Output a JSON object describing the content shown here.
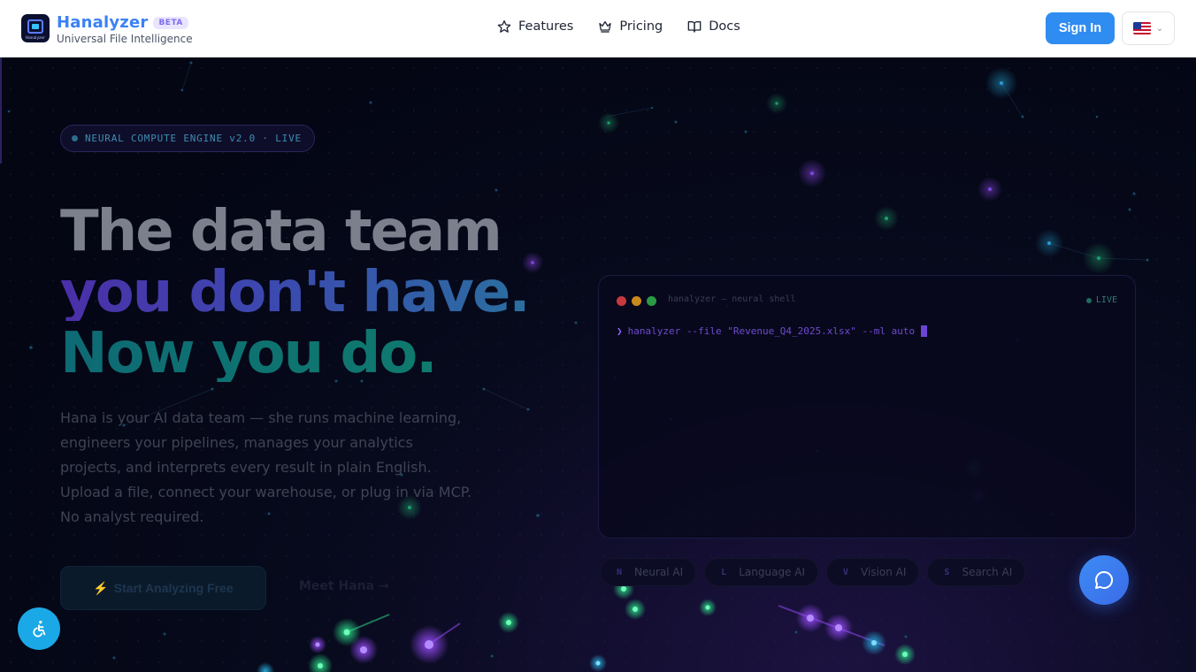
{
  "header": {
    "brand_name": "Hanalyzer",
    "beta_label": "BETA",
    "tagline": "Universal File Intelligence",
    "logo_text": "Hanalyzer",
    "nav": [
      {
        "label": "Features",
        "icon": "star-icon"
      },
      {
        "label": "Pricing",
        "icon": "crown-icon"
      },
      {
        "label": "Docs",
        "icon": "book-icon"
      }
    ],
    "sign_in_label": "Sign In",
    "language": {
      "selected": "en-US",
      "icon": "us-flag-icon"
    }
  },
  "hero": {
    "badge": "NEURAL COMPUTE ENGINE v2.0 · LIVE",
    "headline_line1": "The data team",
    "headline_line2": "you don't have.",
    "headline_line3": "Now you do.",
    "description": "Hana is your AI data team — she runs machine learning, engineers your pipelines, manages your analytics projects, and interprets every result in plain English. Upload a file, connect your warehouse, or plug in via MCP. No analyst required.",
    "cta_primary": "Start Analyzing Free",
    "cta_primary_icon": "⚡",
    "cta_secondary": "Meet Hana →"
  },
  "terminal": {
    "title": "hanalyzer — neural shell",
    "live_label": "LIVE",
    "prompt": "❯",
    "command": "hanalyzer --file \"Revenue_Q4_2025.xlsx\" --ml auto"
  },
  "ai_chips": [
    {
      "letter": "N",
      "label": "Neural AI"
    },
    {
      "letter": "L",
      "label": "Language AI"
    },
    {
      "letter": "V",
      "label": "Vision AI"
    },
    {
      "letter": "S",
      "label": "Search AI"
    }
  ],
  "colors": {
    "brand": "#3b82f6",
    "background": "#040614",
    "accent_purple": "#6b44d6",
    "accent_teal": "#0f7a6e"
  },
  "floating": {
    "accessibility_icon": "accessibility-icon",
    "chat_icon": "chat-bubble-icon"
  }
}
